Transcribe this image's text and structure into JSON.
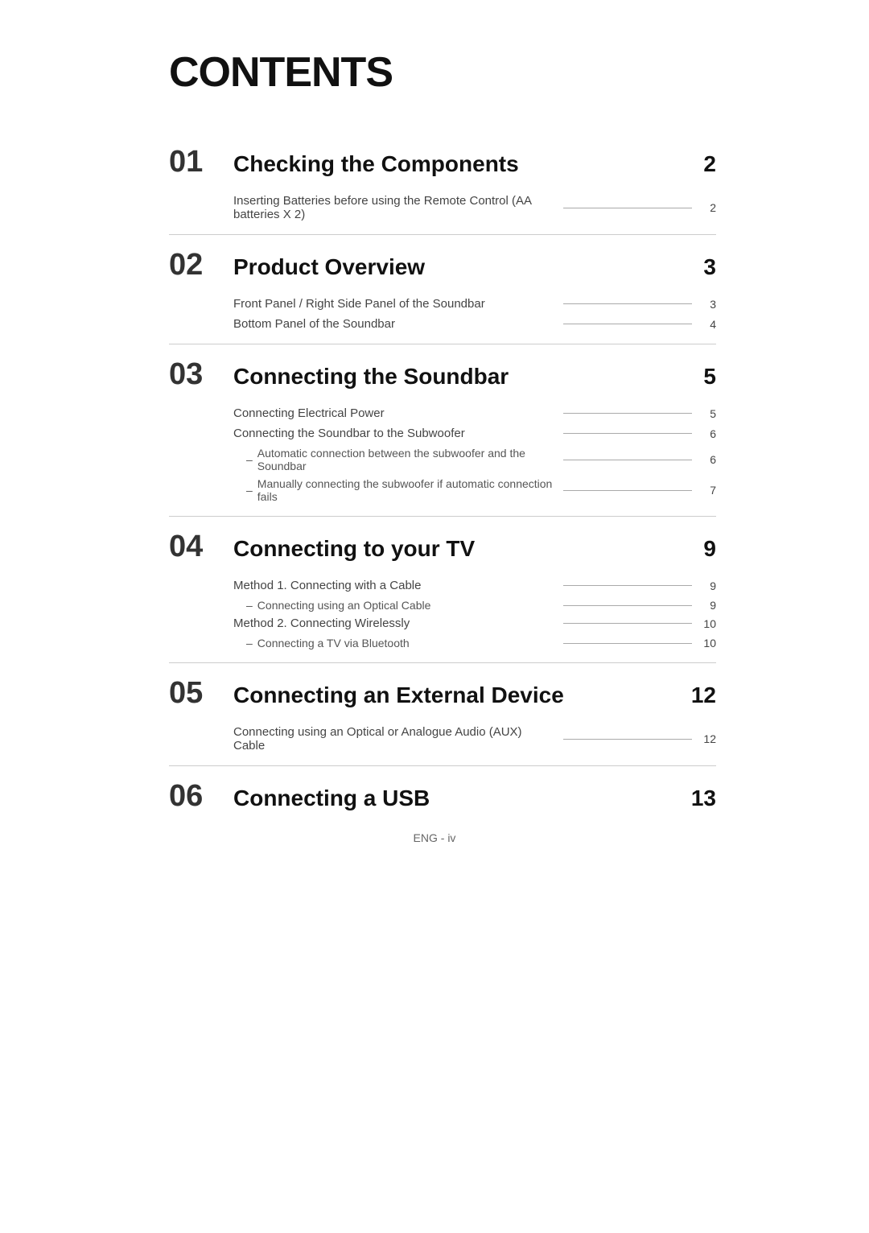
{
  "page": {
    "title": "CONTENTS",
    "footer": "ENG - iv",
    "sections": [
      {
        "number": "01",
        "title": "Checking the Components",
        "page": "2",
        "items": [
          {
            "text": "Inserting Batteries before using the Remote Control (AA batteries X 2)",
            "page": "2",
            "sub": false
          }
        ]
      },
      {
        "number": "02",
        "title": "Product Overview",
        "page": "3",
        "items": [
          {
            "text": "Front Panel / Right Side Panel of the Soundbar",
            "page": "3",
            "sub": false
          },
          {
            "text": "Bottom Panel of the Soundbar",
            "page": "4",
            "sub": false
          }
        ]
      },
      {
        "number": "03",
        "title": "Connecting the Soundbar",
        "page": "5",
        "items": [
          {
            "text": "Connecting Electrical Power",
            "page": "5",
            "sub": false
          },
          {
            "text": "Connecting the Soundbar to the Subwoofer",
            "page": "6",
            "sub": false
          },
          {
            "text": "Automatic connection between the subwoofer and the Soundbar",
            "page": "6",
            "sub": true
          },
          {
            "text": "Manually connecting the subwoofer if automatic connection fails",
            "page": "7",
            "sub": true
          }
        ]
      },
      {
        "number": "04",
        "title": "Connecting to your TV",
        "page": "9",
        "items": [
          {
            "text": "Method 1. Connecting with a Cable",
            "page": "9",
            "sub": false
          },
          {
            "text": "Connecting using an Optical Cable",
            "page": "9",
            "sub": true
          },
          {
            "text": "Method 2. Connecting Wirelessly",
            "page": "10",
            "sub": false
          },
          {
            "text": "Connecting a TV via Bluetooth",
            "page": "10",
            "sub": true
          }
        ]
      },
      {
        "number": "05",
        "title": "Connecting an External Device",
        "page": "12",
        "items": [
          {
            "text": "Connecting using an Optical or Analogue Audio (AUX) Cable",
            "page": "12",
            "sub": false
          }
        ]
      },
      {
        "number": "06",
        "title": "Connecting a USB",
        "page": "13",
        "items": []
      }
    ]
  }
}
